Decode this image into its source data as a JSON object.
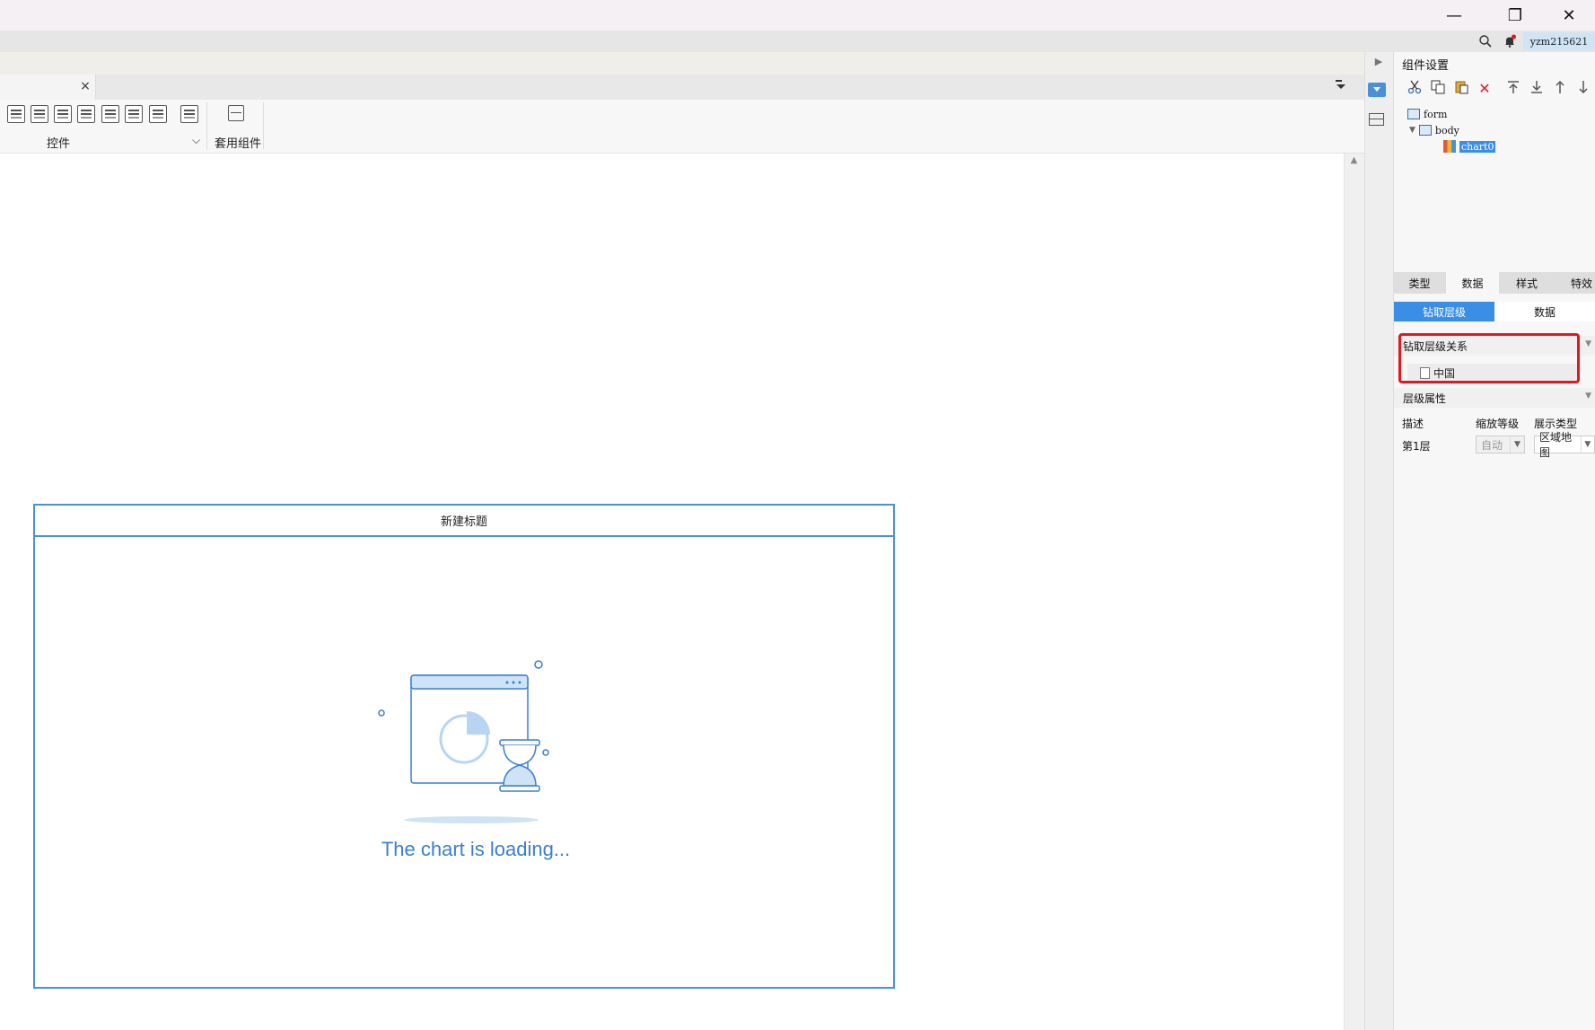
{
  "window": {
    "minimize_glyph": "—",
    "restore_glyph": "❐",
    "close_glyph": "✕"
  },
  "statusbar": {
    "user": "yzm215621"
  },
  "editor_tab": {
    "close_glyph": "×"
  },
  "ribbon": {
    "controls_label": "控件",
    "controls_dropdown": "⌵",
    "preset_label": "套用组件"
  },
  "chart_widget": {
    "title": "新建标题",
    "loading_text": "The chart is loading..."
  },
  "panel": {
    "title": "组件设置",
    "tree": {
      "form": "form",
      "body": "body",
      "chart": "chart0"
    },
    "tabs": [
      "类型",
      "数据",
      "样式",
      "特效"
    ],
    "active_tab": "数据",
    "subtabs": [
      "钻取层级",
      "数据"
    ],
    "active_subtab": "钻取层级",
    "drill_section": "钻取层级关系",
    "drill_node": "中国",
    "level_section": "层级属性",
    "level_headers": {
      "desc": "描述",
      "zoom": "缩放等级",
      "display": "展示类型"
    },
    "level_row": {
      "name": "第1层",
      "zoom": "自动",
      "display": "区域地图"
    }
  },
  "colors": {
    "accent": "#3a8ee6",
    "chart_border": "#4a90d9",
    "highlight": "#e3171d"
  }
}
